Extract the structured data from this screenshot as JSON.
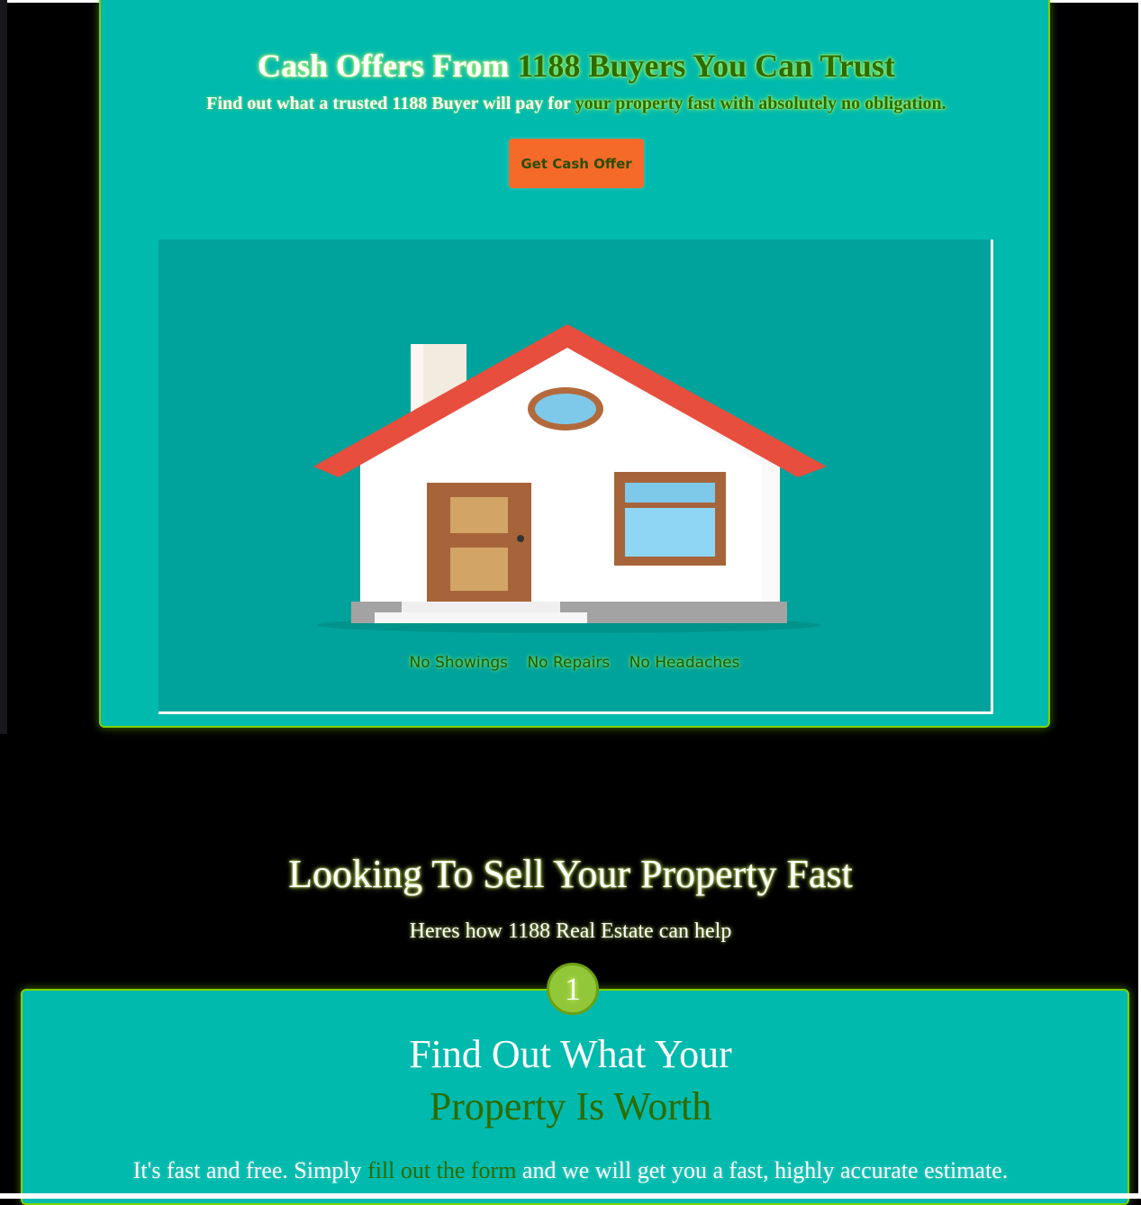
{
  "hero": {
    "title_part1": "Cash Offers From ",
    "title_part2": "1188 Buyers You Can Trust",
    "subtitle_part1": "Find out what a trusted 1188 Buyer will pay for ",
    "subtitle_part2": "your property fast with absolutely no obligation.",
    "cta_label": "Get Cash Offer",
    "benefits": [
      "No Showings",
      "No Repairs",
      "No Headaches"
    ]
  },
  "section": {
    "title": "Looking To Sell Your Property Fast",
    "subtitle": "Heres how 1188 Real Estate can help"
  },
  "step1": {
    "number": "1",
    "title_line1": "Find Out What Your",
    "title_line2": "Property Is Worth",
    "desc_part1": "It's fast and free. Simply ",
    "desc_link": "fill out the form",
    "desc_part2": " and we will get you a fast, highly accurate estimate."
  },
  "colors": {
    "teal": "#00baad",
    "image_teal": "#00a39b",
    "accent_green": "#7ed100",
    "cta_orange": "#f56a28",
    "text_green": "#2e6b00"
  },
  "icons": [
    "house-illustration"
  ]
}
